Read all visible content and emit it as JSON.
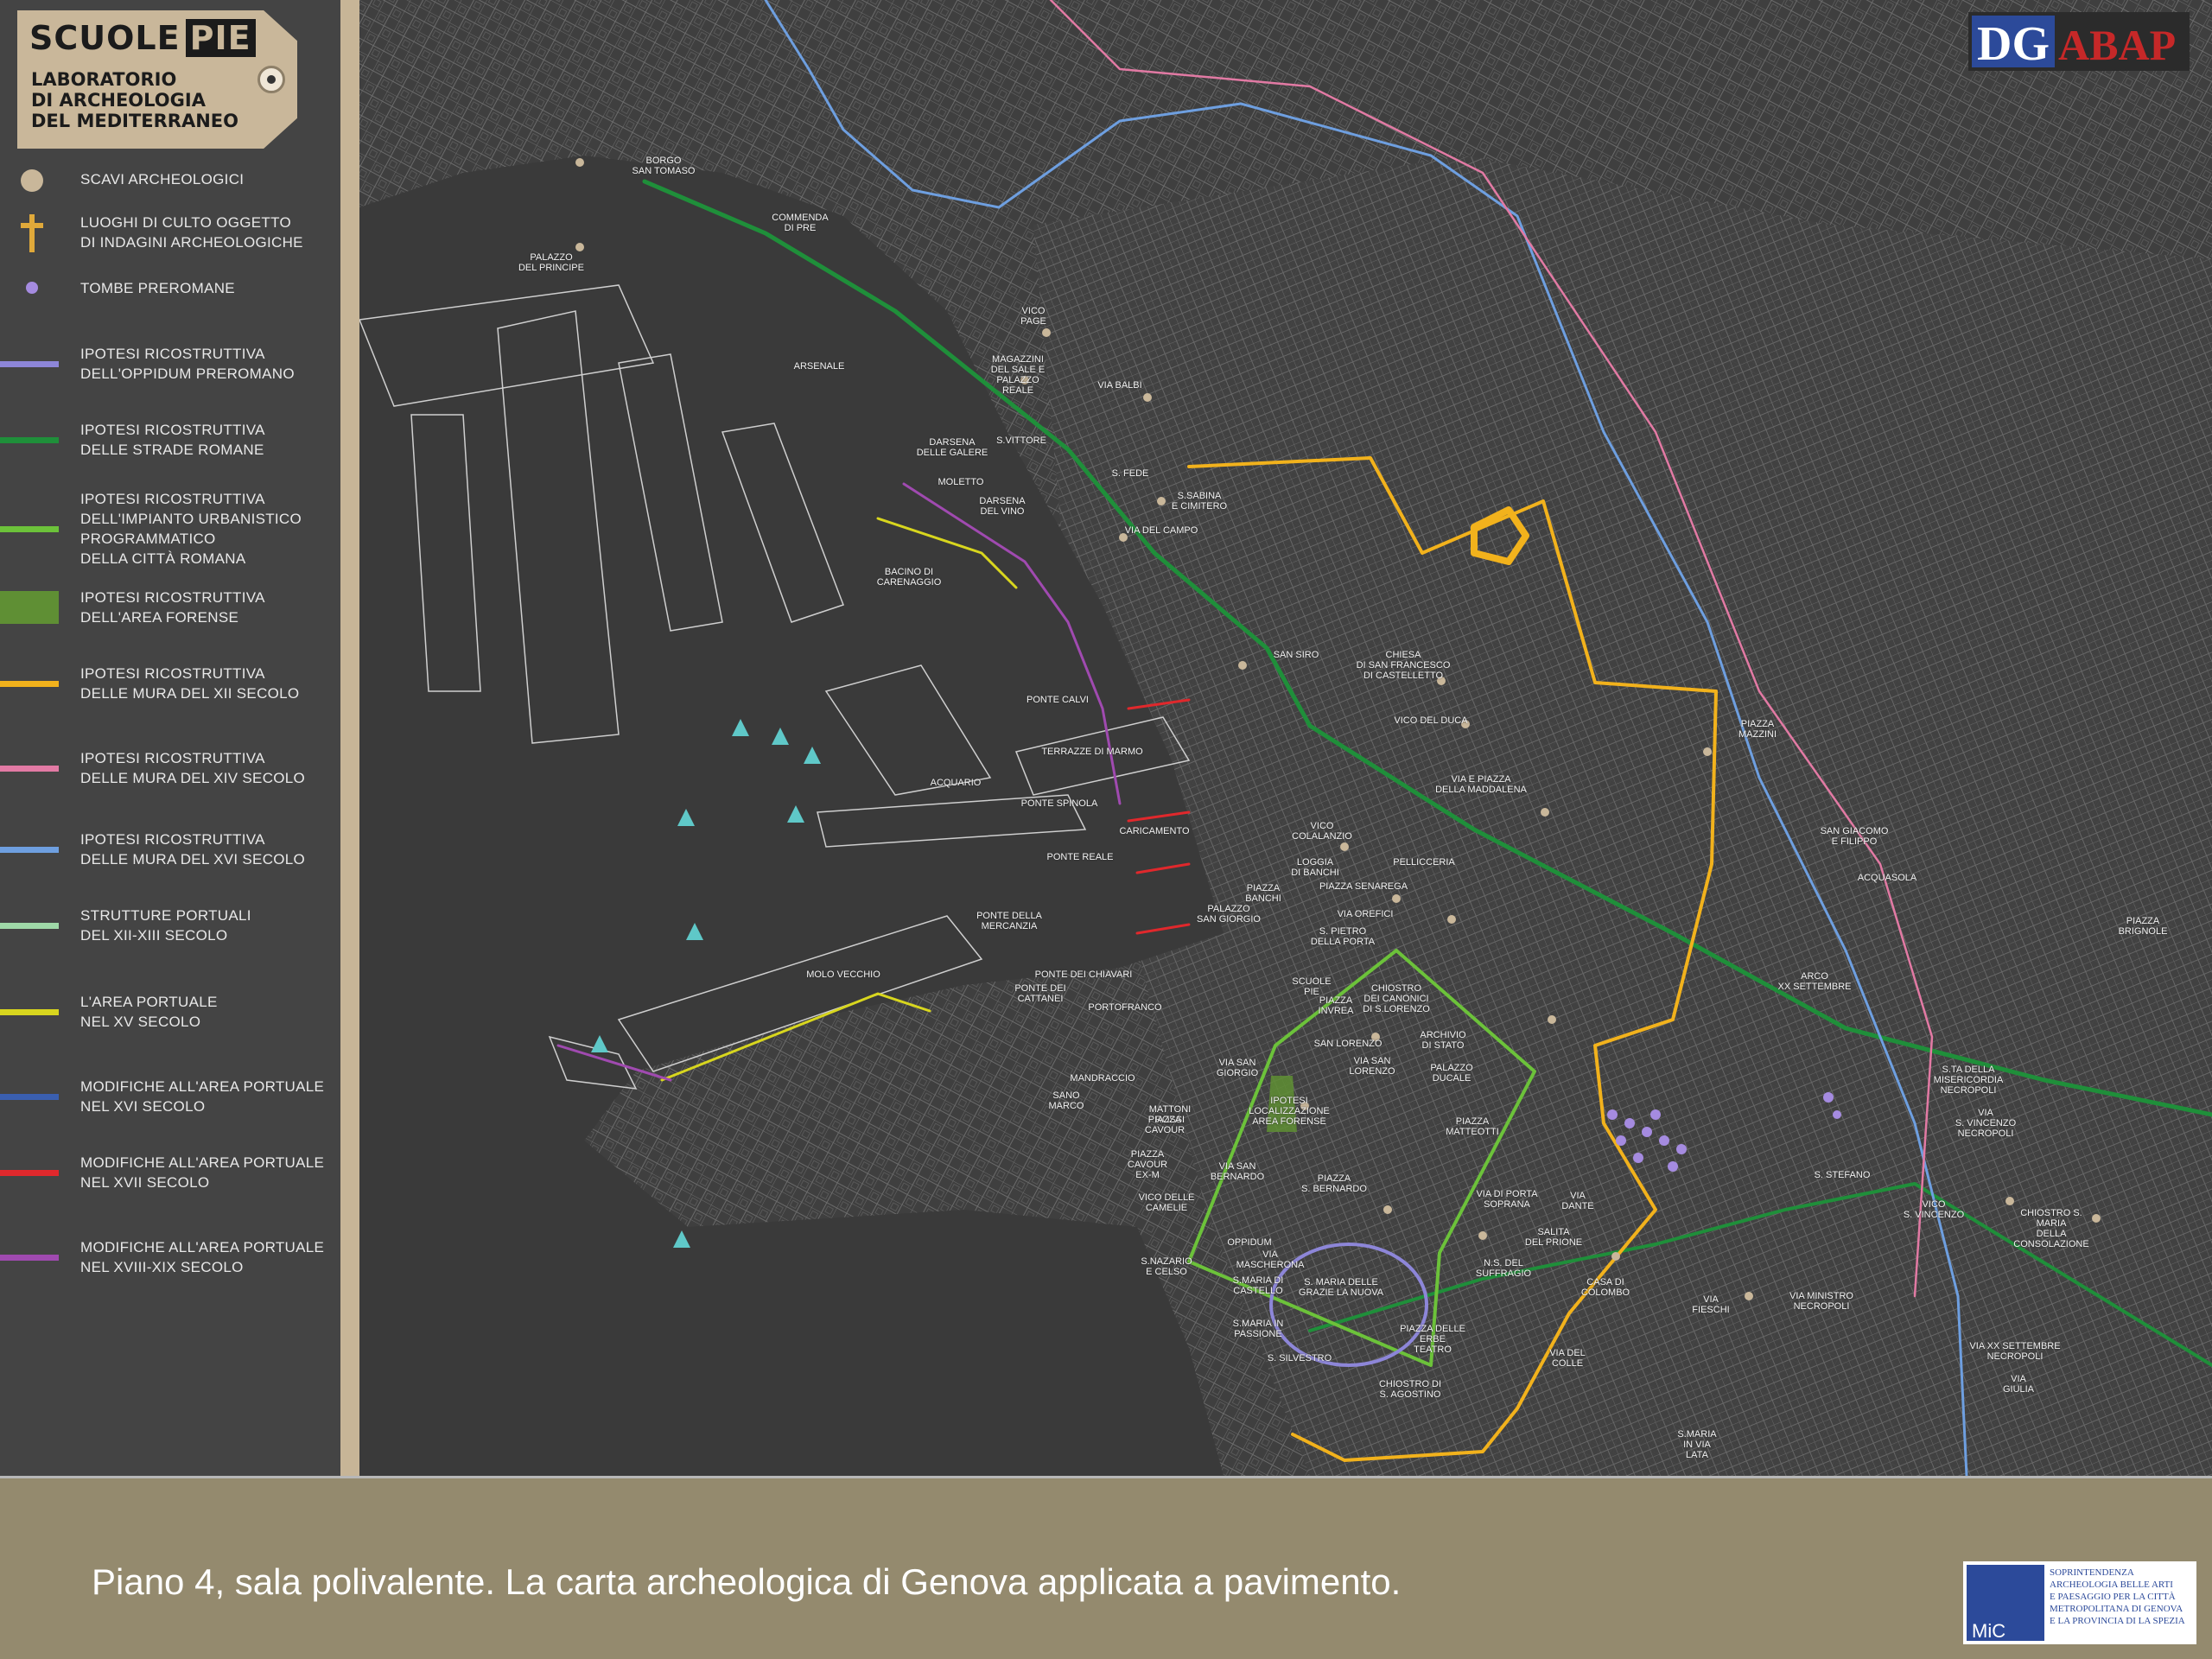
{
  "legend": {
    "logo": {
      "title_a": "SCUOLE",
      "title_b": "PIE",
      "subtitle": "LABORATORIO\nDI ARCHEOLOGIA\nDEL MEDITERRANEO"
    },
    "items": [
      {
        "label": "SCAVI ARCHEOLOGICI",
        "symbol": "dot",
        "color": "#c9b79a"
      },
      {
        "label": "LUOGHI DI CULTO OGGETTO\nDI INDAGINI ARCHEOLOGICHE",
        "symbol": "cross",
        "color": "#e0a93a"
      },
      {
        "label": "TOMBE PREROMANE",
        "symbol": "small-dot",
        "color": "#a58be0"
      },
      {
        "label": "IPOTESI RICOSTRUTTIVA\nDELL'OPPIDUM PREROMANO",
        "symbol": "line",
        "color": "#8d86d8"
      },
      {
        "label": "IPOTESI RICOSTRUTTIVA\nDELLE STRADE ROMANE",
        "symbol": "line",
        "color": "#1f8f3a"
      },
      {
        "label": "IPOTESI RICOSTRUTTIVA\nDELL'IMPIANTO URBANISTICO\nPROGRAMMATICO\nDELLA CITTÀ ROMANA",
        "symbol": "line",
        "color": "#6cc23a"
      },
      {
        "label": "IPOTESI RICOSTRUTTIVA\nDELL'AREA FORENSE",
        "symbol": "area",
        "color": "#5f8f34"
      },
      {
        "label": "IPOTESI RICOSTRUTTIVA\nDELLE MURA DEL XII SECOLO",
        "symbol": "line",
        "color": "#f2b21c"
      },
      {
        "label": "IPOTESI RICOSTRUTTIVA\nDELLE MURA DEL XIV SECOLO",
        "symbol": "line",
        "color": "#e27aa4"
      },
      {
        "label": "IPOTESI RICOSTRUTTIVA\nDELLE MURA DEL XVI SECOLO",
        "symbol": "line",
        "color": "#6e9fe0"
      },
      {
        "label": "STRUTTURE PORTUALI\nDEL XII-XIII SECOLO",
        "symbol": "line",
        "color": "#9fd9a8"
      },
      {
        "label": "L'AREA PORTUALE\nNEL XV SECOLO",
        "symbol": "line",
        "color": "#d8d61e"
      },
      {
        "label": "MODIFICHE ALL'AREA PORTUALE\nNEL XVI SECOLO",
        "symbol": "line",
        "color": "#3a5fb0"
      },
      {
        "label": "MODIFICHE ALL'AREA PORTUALE\nNEL XVII SECOLO",
        "symbol": "line",
        "color": "#e0282c"
      },
      {
        "label": "MODIFICHE ALL'AREA PORTUALE\nNEL XVIII-XIX SECOLO",
        "symbol": "line",
        "color": "#a04ab0"
      }
    ]
  },
  "map": {
    "labels": [
      "BORGO\nSAN TOMASO",
      "PALAZZO\nDEL PRINCIPE",
      "COMMENDA\nDI PRE",
      "ARSENALE",
      "VICO\nPAGE",
      "MAGAZZINI\nDEL SALE E\nPALAZZO\nREALE",
      "VIA BALBI",
      "DARSENA\nDELLE GALERE",
      "S.VITTORE",
      "MOLETTO",
      "DARSENA\nDEL VINO",
      "S. FEDE",
      "S.SABINA\nE CIMITERO",
      "VIA DEL CAMPO",
      "BACINO DI CARENAGGIO",
      "SAN SIRO",
      "CHIESA\nDI SAN FRANCESCO\nDI CASTELLETTO",
      "VICO DEL DUCA",
      "PIAZZA\nMAZZINI",
      "PONTE CALVI",
      "TERRAZZE DI MARMO",
      "ACQUARIO",
      "PONTE SPINOLA",
      "VIA E PIAZZA\nDELLA MADDALENA",
      "CARICAMENTO",
      "VICO\nCOLALANZIO",
      "PONTE REALE",
      "LOGGIA\nDI BANCHI",
      "PIAZZA SENAREGA",
      "PIAZZA\nBANCHI",
      "PELLICCERIA",
      "PALAZZO\nSAN GIORGIO",
      "VIA OREFICI",
      "S. PIETRO\nDELLA PORTA",
      "PONTE DELLA MERCANZIA",
      "SAN GIACOMO\nE FILIPPO",
      "ACQUASOLA",
      "PIAZZA\nBRIGNOLE",
      "PONTE DEI CHIAVARI",
      "PONTE DEI\nCATTANEI",
      "PORTOFRANCO",
      "MOLO VECCHIO",
      "MANDRACCIO",
      "SCUOLE\nPIE",
      "PIAZZA\nINVREA",
      "CHIOSTRO\nDEI CANONICI\nDI S.LORENZO",
      "ARCHIVIO\nDI STATO",
      "SAN LORENZO",
      "VIA SAN\nLORENZO",
      "PALAZZO\nDUCALE",
      "ARCO\nXX SETTEMBRE",
      "S.TA DELLA\nMISERICORDIA\nNECROPOLI",
      "VIA\nS. VINCENZO\nNECROPOLI",
      "VIA SAN\nGIORGIO",
      "IPOTESI\nLOCALIZZAZIONE\nAREA FORENSE",
      "PIAZZA\nMATTEOTTI",
      "SANO\nMARCO",
      "MATTONI\nROSSI",
      "PIAZZA\nCAVOUR",
      "PIAZZA\nCAVOUR\nEX-M",
      "VIA SAN\nBERNARDO",
      "PIAZZA\nS. BERNARDO",
      "VICO DELLE\nCAMELIE",
      "VIA DI PORTA\nSOPRANA",
      "VIA\nDANTE",
      "S. STEFANO",
      "VICO\nS. VINCENZO",
      "CHIOSTRO S.\nMARIA\nDELLA\nCONSOLAZIONE",
      "OPPIDUM",
      "VIA\nMASCHERONA",
      "SALITA\nDEL PRIONE",
      "S.NAZARIO\nE CELSO",
      "S.MARIA DI\nCASTELLO",
      "S. MARIA DELLE\nGRAZIE LA NUOVA",
      "N.S. DEL\nSUFFRAGIO",
      "CASA DI\nCOLOMBO",
      "VIA\nFIESCHI",
      "VIA MINISTRO\nNECROPOLI",
      "VIA XX SETTEMBRE\nNECROPOLI",
      "S.MARIA IN\nPASSIONE",
      "PIAZZA DELLE\nERBE\nTEATRO",
      "S. SILVESTRO",
      "VIA DEL\nCOLLE",
      "CHIOSTRO DI\nS. AGOSTINO",
      "VIA\nGIULIA",
      "S.MARIA\nIN VIA\nLATA"
    ]
  },
  "logos": {
    "dg_text": "DG",
    "abap_text": "ABAP",
    "mic_text": "MiC",
    "mic_description": "SOPRINTENDENZA\nARCHEOLOGIA BELLE ARTI\nE PAESAGGIO PER LA CITTÀ\nMETROPOLITANA DI GENOVA\nE LA PROVINCIA DI LA SPEZIA"
  },
  "caption": "Piano 4, sala polivalente. La carta archeologica di Genova applicata a pavimento."
}
